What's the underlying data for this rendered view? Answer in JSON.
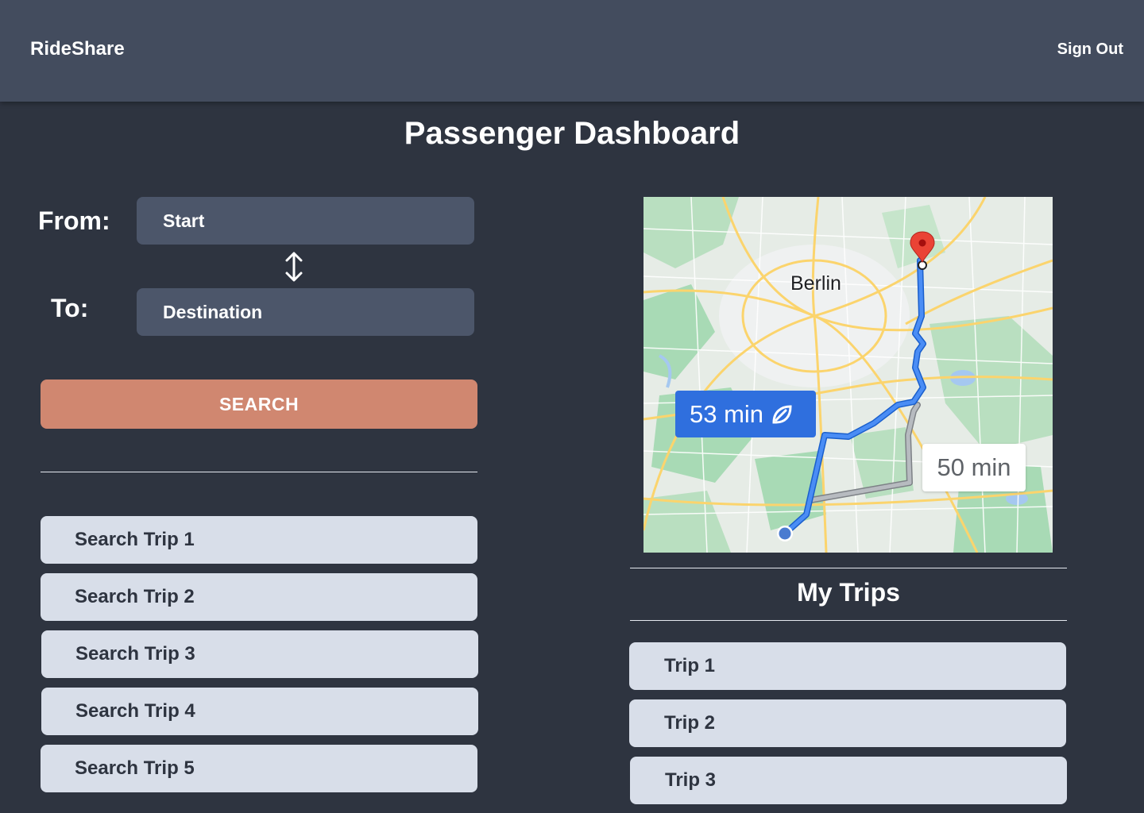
{
  "header": {
    "brand": "RideShare",
    "sign_out": "Sign Out"
  },
  "page_title": "Passenger Dashboard",
  "form": {
    "from_label": "From:",
    "from_value": "Start",
    "to_label": "To:",
    "to_value": "Destination",
    "swap_icon": "swap-vertical-icon",
    "search_label": "SEARCH"
  },
  "search_results": [
    {
      "label": "Search Trip 1"
    },
    {
      "label": "Search Trip 2"
    },
    {
      "label": "Search Trip 3"
    },
    {
      "label": "Search Trip 4"
    },
    {
      "label": "Search Trip 5"
    }
  ],
  "map": {
    "city_label": "Berlin",
    "primary_route_time": "53 min",
    "alt_route_time": "50 min",
    "eco_icon": "leaf-icon",
    "destination_icon": "map-pin-icon",
    "colors": {
      "primary_route": "#4285f4",
      "alt_route": "#9aa0a6",
      "pin": "#ea4335",
      "land": "#e8eaed",
      "park": "#a8dab5",
      "major_road": "#fbd46d"
    }
  },
  "my_trips": {
    "title": "My Trips",
    "items": [
      {
        "label": "Trip 1"
      },
      {
        "label": "Trip 2"
      },
      {
        "label": "Trip 3"
      }
    ]
  },
  "colors": {
    "background": "#2e3440",
    "topbar": "#434c5e",
    "input": "#4c566a",
    "accent": "#d08770",
    "list_item": "#d8dee9"
  }
}
